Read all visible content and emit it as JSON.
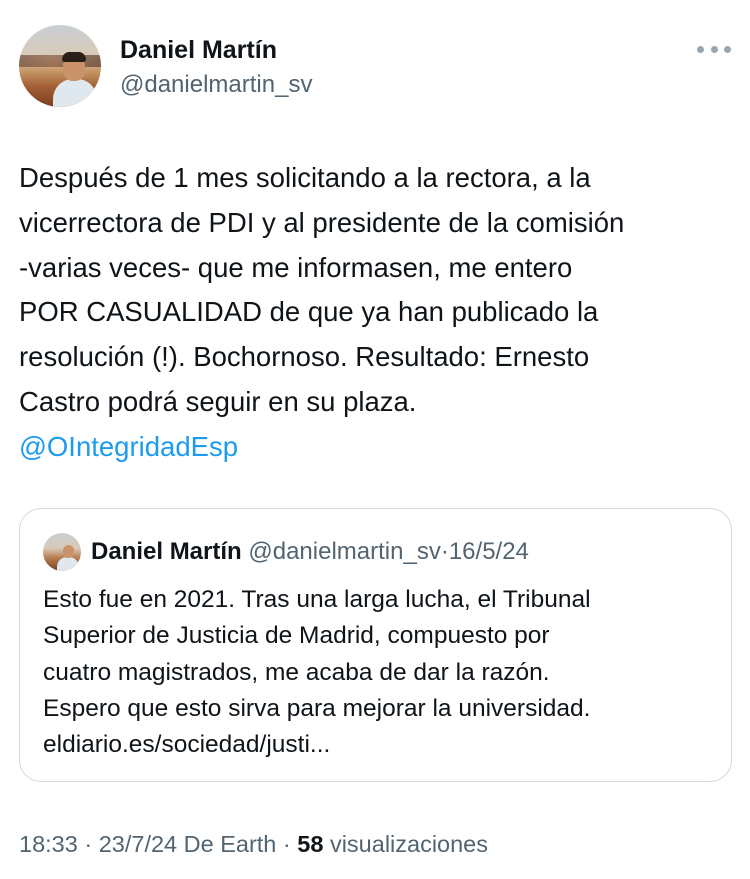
{
  "author": {
    "name": "Daniel Martín",
    "handle": "@danielmartin_sv"
  },
  "post": {
    "lines": [
      "Después de 1 mes solicitando a la rectora, a la",
      "vicerrectora de PDI y al presidente de la comisión",
      "-varias veces- que me informasen, me entero",
      "POR CASUALIDAD de que ya han publicado la",
      "resolución (!). Bochornoso. Resultado: Ernesto",
      "Castro podrá seguir en su plaza."
    ],
    "mention": "@OIntegridadEsp"
  },
  "quote": {
    "name": "Daniel Martín",
    "handle": "@danielmartin_sv",
    "separator": "·",
    "date": "16/5/24",
    "lines": [
      "Esto fue en 2021. Tras una larga lucha, el Tribunal",
      "Superior de Justicia de Madrid, compuesto por",
      "cuatro magistrados, me acaba de dar la razón.",
      "Espero que esto sirva para mejorar la universidad.",
      "eldiario.es/sociedad/justi..."
    ]
  },
  "footer": {
    "time": "18:33",
    "separator": "·",
    "date": "23/7/24",
    "source": "De Earth",
    "views_count": "58",
    "views_label": "visualizaciones"
  },
  "icons": {
    "more": "more-options-icon",
    "avatar": "profile-avatar"
  },
  "colors": {
    "text": "#0f1419",
    "secondary": "#536471",
    "link": "#1d9bf0",
    "border": "#cfd9de"
  }
}
